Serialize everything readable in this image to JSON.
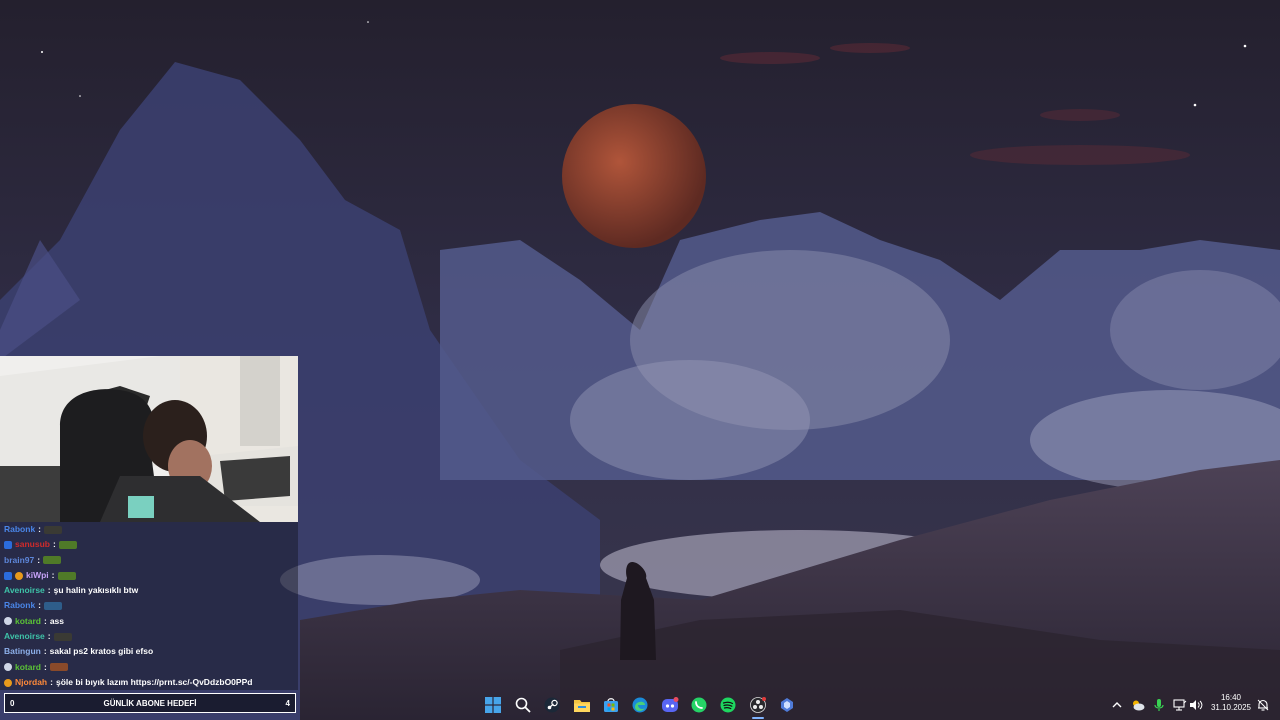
{
  "chat": {
    "messages": [
      {
        "user": "Rabonk",
        "user_color": "#4a86e8",
        "text": "",
        "badge": "",
        "emote": "#3a3a34"
      },
      {
        "user": "sanusub",
        "user_color": "#d02b2b",
        "text": "",
        "badge": "blue",
        "emote": "#4f7a28"
      },
      {
        "user": "brain97",
        "user_color": "#5d86d9",
        "text": "",
        "badge": "",
        "emote": "#4f7a28"
      },
      {
        "user": "kiWpi",
        "user_color": "#c6a2f7",
        "text": "",
        "badge": "blue+orange",
        "emote": "#4f7a28"
      },
      {
        "user": "Avenoirse",
        "user_color": "#3ec3a8",
        "text": "şu halin yakısıklı btw",
        "badge": "",
        "emote": ""
      },
      {
        "user": "Rabonk",
        "user_color": "#4a86e8",
        "text": "",
        "badge": "",
        "emote": "#2e5d8a"
      },
      {
        "user": "kotard",
        "user_color": "#5bc236",
        "text": "ass",
        "badge": "mic",
        "emote": ""
      },
      {
        "user": "Avenoirse",
        "user_color": "#3ec3a8",
        "text": "",
        "badge": "",
        "emote": "#3a3a34"
      },
      {
        "user": "Batingun",
        "user_color": "#8db0ea",
        "text": "sakal ps2 kratos gibi efso",
        "badge": "",
        "emote": ""
      },
      {
        "user": "kotard",
        "user_color": "#5bc236",
        "text": "",
        "badge": "mic",
        "emote": "#8a4a2a"
      },
      {
        "user": "Njordah",
        "user_color": "#ff8a3a",
        "text": "şöle bi bıyık lazım https://prnt.sc/-QvDdzbO0PPd",
        "badge": "orange",
        "emote": ""
      }
    ],
    "separator": ":"
  },
  "goal": {
    "left_value": "0",
    "title": "GÜNLİK ABONE HEDEFİ",
    "right_value": "4"
  },
  "taskbar": {
    "icons": [
      "windows-start-icon",
      "search-icon",
      "steam-icon",
      "file-explorer-icon",
      "microsoft-store-icon",
      "edge-icon",
      "discord-icon",
      "whatsapp-icon",
      "spotify-icon",
      "obs-icon",
      "app-icon"
    ]
  },
  "tray": {
    "time": "16:40",
    "date": "31.10.2025"
  }
}
